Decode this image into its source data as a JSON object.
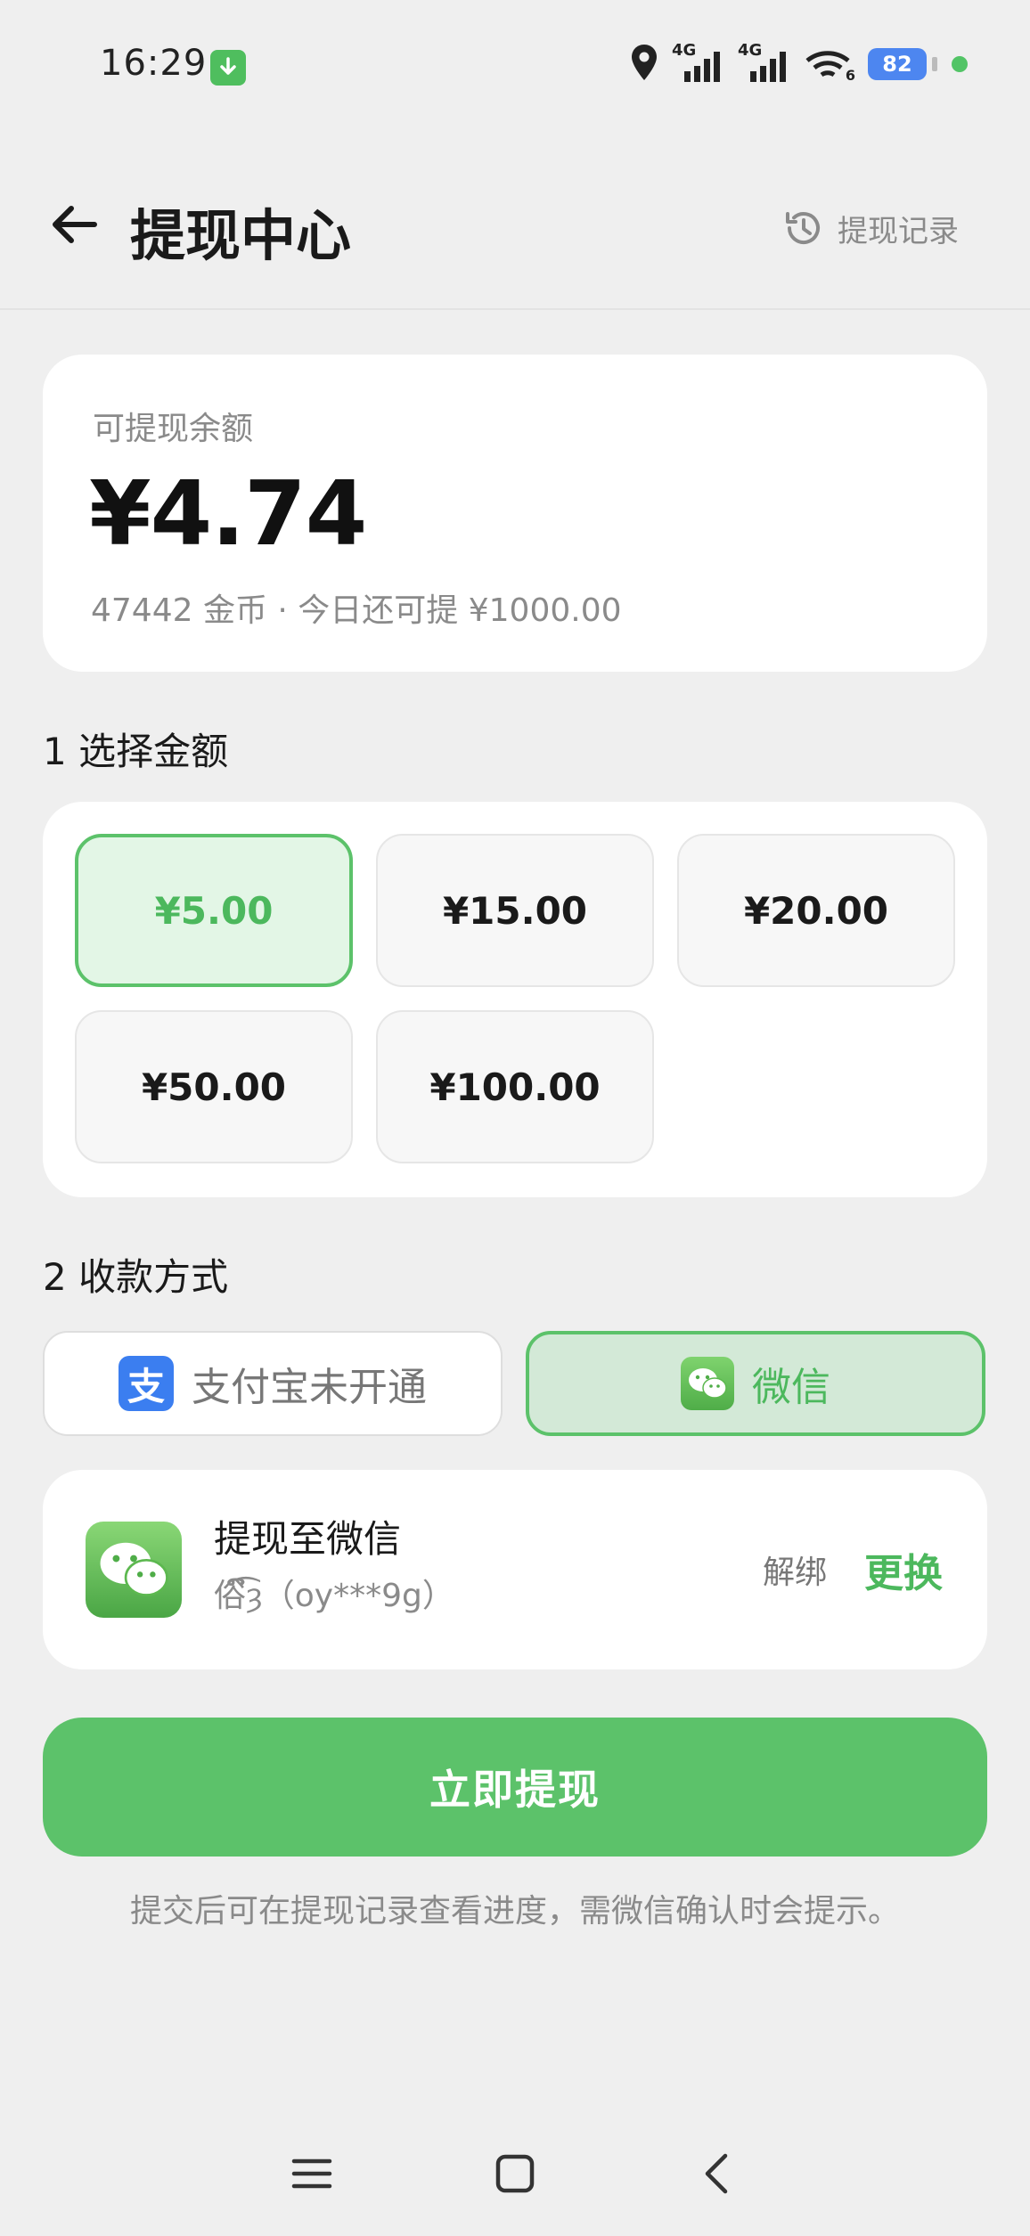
{
  "status_bar": {
    "time": "16:29",
    "battery": "82",
    "network_1": "4G",
    "network_2": "4G",
    "wifi_sub": "6"
  },
  "header": {
    "title": "提现中心",
    "history_label": "提现记录"
  },
  "balance": {
    "label": "可提现余额",
    "value": "¥4.74",
    "sub": "47442 金币 · 今日还可提 ¥1000.00"
  },
  "amount_section": {
    "title": "1 选择金额",
    "options": [
      "¥5.00",
      "¥15.00",
      "¥20.00",
      "¥50.00",
      "¥100.00"
    ],
    "selected": "¥5.00"
  },
  "payment_section": {
    "title": "2 收款方式",
    "alipay_logo_char": "支",
    "alipay_label": "支付宝未开通",
    "wechat_label": "微信",
    "selected": "微信"
  },
  "account": {
    "title": "提现至微信",
    "sub": "俗ົ͡ȝ（oy***9g）",
    "unbind_label": "解绑",
    "change_label": "更换"
  },
  "submit_label": "立即提现",
  "hint": "提交后可在提现记录查看进度，需微信确认时会提示。",
  "colors": {
    "accent": "#5cc26a",
    "accent_text": "#4cb85d",
    "background": "#efefef",
    "alipay_blue": "#3b7ef0",
    "battery_blue": "#4d86f0"
  }
}
